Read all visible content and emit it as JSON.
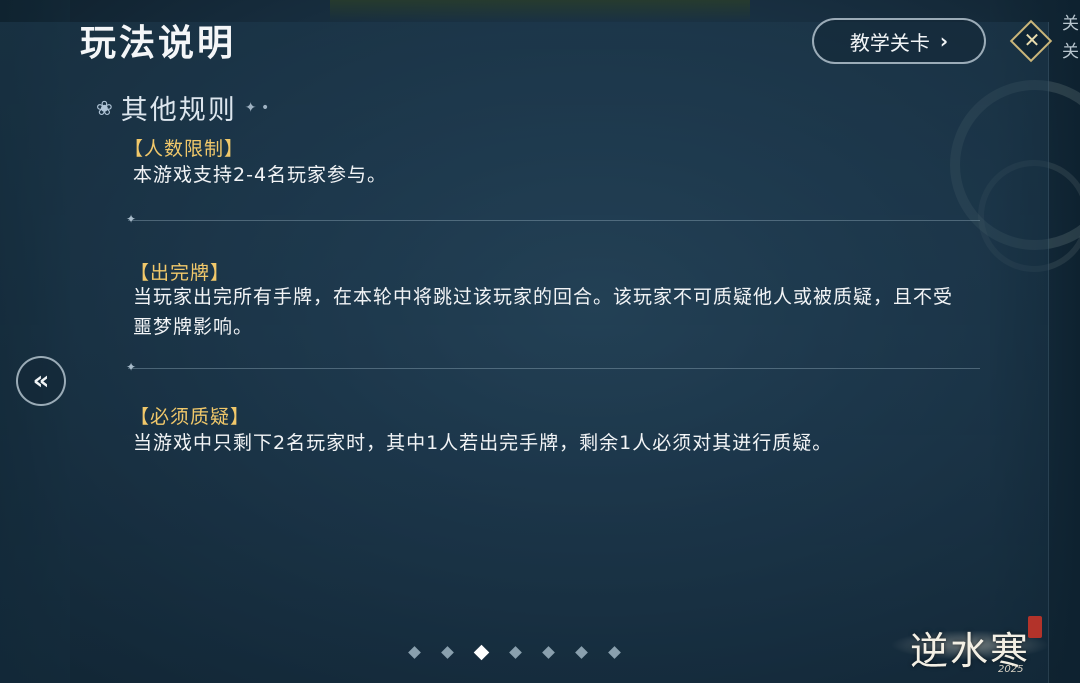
{
  "header": {
    "title": "玩法说明",
    "tutorial_button": "教学关卡",
    "close_label": "关关"
  },
  "section": {
    "title": "其他规则"
  },
  "rules": [
    {
      "title": "【人数限制】",
      "body": "本游戏支持2-4名玩家参与。"
    },
    {
      "title": "【出完牌】",
      "body": "当玩家出完所有手牌，在本轮中将跳过该玩家的回合。该玩家不可质疑他人或被质疑，且不受噩梦牌影响。"
    },
    {
      "title": "【必须质疑】",
      "body": "当游戏中只剩下2名玩家时，其中1人若出完手牌，剩余1人必须对其进行质疑。"
    }
  ],
  "pager": {
    "total": 7,
    "current": 3
  },
  "logo": {
    "text": "逆水寒",
    "year": "2025"
  },
  "colors": {
    "rule_title": "#f1c86a",
    "panel": "#1f3a4f"
  },
  "icons": {
    "close": "close-icon",
    "arrow_left": "double-chevron-left-icon",
    "chevron_right": "chevron-right-icon",
    "paw": "paw-icon"
  }
}
